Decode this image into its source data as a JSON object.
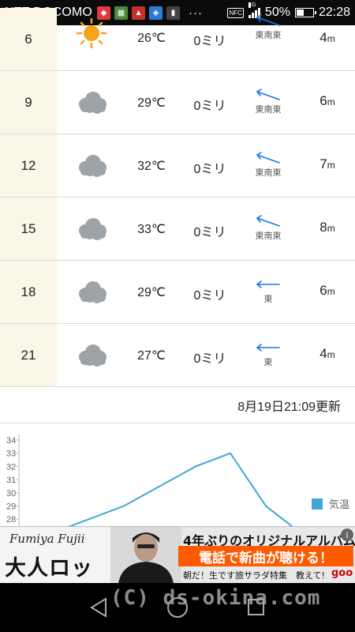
{
  "status_bar": {
    "carrier": "NTT DOCOMO",
    "more": "···",
    "nfc": "NFC",
    "network": "4G",
    "battery": "50%",
    "battery_level": 0.5,
    "time": "22:28"
  },
  "forecast": {
    "rows": [
      {
        "hour": "6",
        "weather_icon": "sun-icon",
        "temp": "26℃",
        "precip": "0ミリ",
        "wind_dir": "",
        "speed": "4",
        "speed_unit": "m"
      },
      {
        "hour": "9",
        "weather_icon": "cloud-icon",
        "temp": "29℃",
        "precip": "0ミリ",
        "wind_dir": "東南東",
        "speed": "6",
        "speed_unit": "m"
      },
      {
        "hour": "12",
        "weather_icon": "cloud-icon",
        "temp": "32℃",
        "precip": "0ミリ",
        "wind_dir": "東南東",
        "speed": "7",
        "speed_unit": "m"
      },
      {
        "hour": "15",
        "weather_icon": "cloud-icon",
        "temp": "33℃",
        "precip": "0ミリ",
        "wind_dir": "東南東",
        "speed": "8",
        "speed_unit": "m"
      },
      {
        "hour": "18",
        "weather_icon": "cloud-icon",
        "temp": "29℃",
        "precip": "0ミリ",
        "wind_dir": "東",
        "speed": "6",
        "speed_unit": "m"
      },
      {
        "hour": "21",
        "weather_icon": "cloud-icon",
        "temp": "27℃",
        "precip": "0ミリ",
        "wind_dir": "東",
        "speed": "4",
        "speed_unit": "m"
      }
    ],
    "partial_first_wind_dir": "東南東"
  },
  "updated": "8月19日21:09更新",
  "chart_data": {
    "type": "line",
    "title": "",
    "xlabel": "",
    "ylabel": "",
    "yticks": [
      "34",
      "33",
      "32",
      "31",
      "30",
      "29",
      "28"
    ],
    "ylim": [
      28,
      34
    ],
    "series": [
      {
        "name": "気温",
        "color": "#3fa7d6",
        "x": [
          "6",
          "9",
          "12",
          "15",
          "18",
          "21"
        ],
        "values": [
          26,
          29,
          32,
          33,
          29,
          27
        ]
      }
    ],
    "legend": "right",
    "grid": false
  },
  "ad": {
    "artist": "Fumiya Fujii",
    "album": "大人ロック",
    "headline": "4年ぶりのオリジナルアルバム",
    "cta": "電話で新曲が聴ける！",
    "subline": "朝だ！生です旅サラダ特集　教えて!",
    "brand": "goo",
    "info": "i"
  },
  "watermark": "(C) ds-okina.com",
  "colors": {
    "hour_bg": "#fbf7e8",
    "arrow": "#1a73e8",
    "line": "#3fa7d6",
    "cloud": "#9ea3a8",
    "sun": "#f7a21b",
    "ad_accent": "#ff5a00"
  }
}
